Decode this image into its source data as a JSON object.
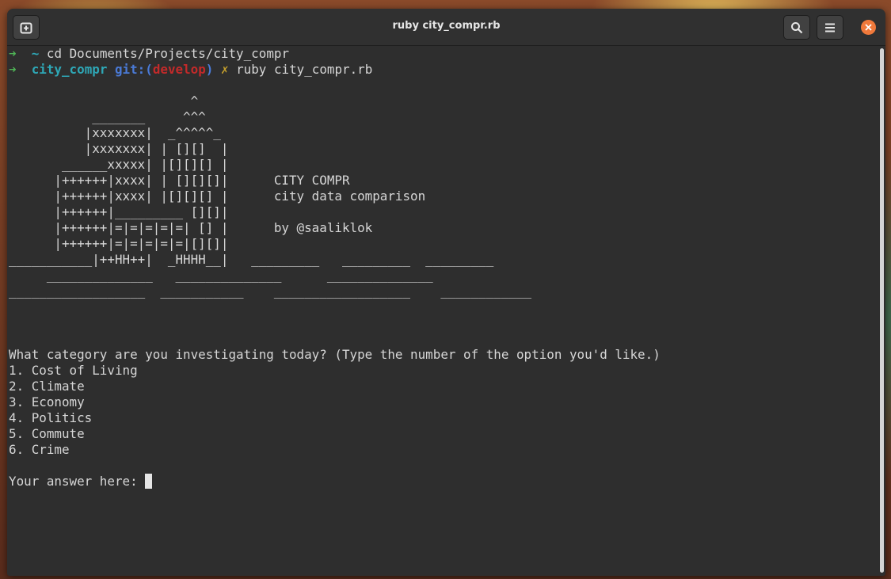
{
  "window": {
    "title": "ruby city_compr.rb"
  },
  "prompt1": {
    "arrow": "➜",
    "dir": "~",
    "command": "cd Documents/Projects/city_compr"
  },
  "prompt2": {
    "arrow": "➜",
    "dir": "city_compr",
    "git_prefix": "git:(",
    "branch": "develop",
    "git_suffix": ")",
    "dirty": "✗",
    "command": "ruby city_compr.rb"
  },
  "ascii_art": [
    "                        ^",
    "           _______     ^^^",
    "          |xxxxxxx|  _^^^^^_",
    "          |xxxxxxx| | [][]  |",
    "       ______xxxxx| |[][][] |",
    "      |++++++|xxxx| | [][][]|      CITY COMPR",
    "      |++++++|xxxx| |[][][] |      city data comparison",
    "      |++++++|_________ [][]|",
    "      |++++++|=|=|=|=|=| [] |      by @saaliklok",
    "      |++++++|=|=|=|=|=|[][]|",
    "___________|++HH++|  _HHHH__|   _________   _________  _________",
    "     ______________   ______________      ______________",
    "__________________  ___________    __________________    ____________"
  ],
  "question": "What category are you investigating today? (Type the number of the option you'd like.)",
  "options": [
    "1. Cost of Living",
    "2. Climate",
    "3. Economy",
    "4. Politics",
    "5. Commute",
    "6. Crime"
  ],
  "answer_prompt": "Your answer here: ",
  "icons": {
    "new_tab": "new-tab-icon",
    "search": "search-icon",
    "menu": "hamburger-menu-icon",
    "close": "close-icon"
  },
  "colors": {
    "accent_close": "#f0793b",
    "prompt_arrow": "#4fb356",
    "dir": "#2ea7b6",
    "git": "#4a7ad6",
    "branch": "#c32a2a"
  }
}
